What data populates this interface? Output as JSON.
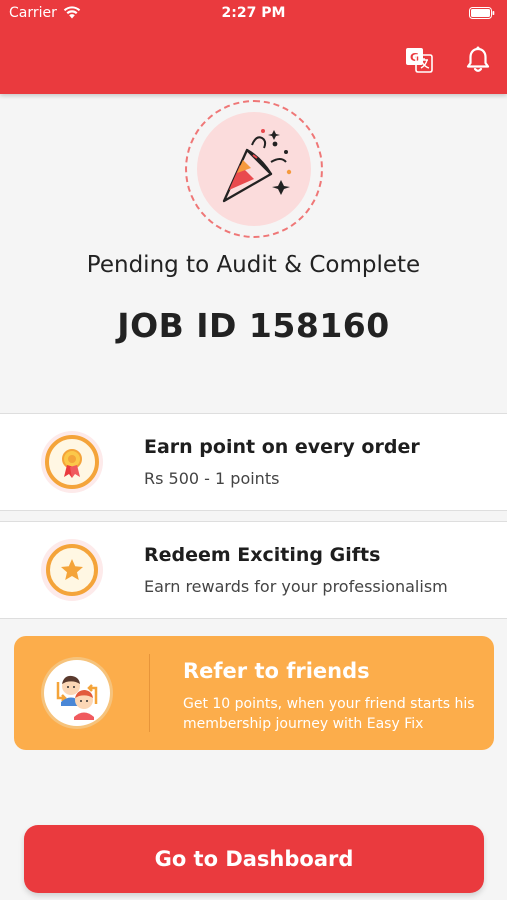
{
  "status_bar": {
    "carrier": "Carrier",
    "time": "2:27 PM"
  },
  "header": {
    "translate_icon": "translate-icon",
    "bell_icon": "bell-icon",
    "brand_color": "#ea3a3e"
  },
  "hero": {
    "icon": "party-popper-icon",
    "status_text": "Pending to Audit & Complete",
    "job_id": "JOB ID 158160"
  },
  "cards": [
    {
      "icon": "medal-icon",
      "title": "Earn point on every order",
      "subtitle": "Rs 500 - 1 points"
    },
    {
      "icon": "star-icon",
      "title": "Redeem Exciting Gifts",
      "subtitle": "Earn rewards for your professionalism"
    }
  ],
  "refer": {
    "icon": "friends-icon",
    "title": "Refer to friends",
    "text": "Get 10 points, when your friend starts his membership journey with Easy Fix",
    "color": "#fcad4b"
  },
  "cta": {
    "label": "Go to Dashboard"
  }
}
